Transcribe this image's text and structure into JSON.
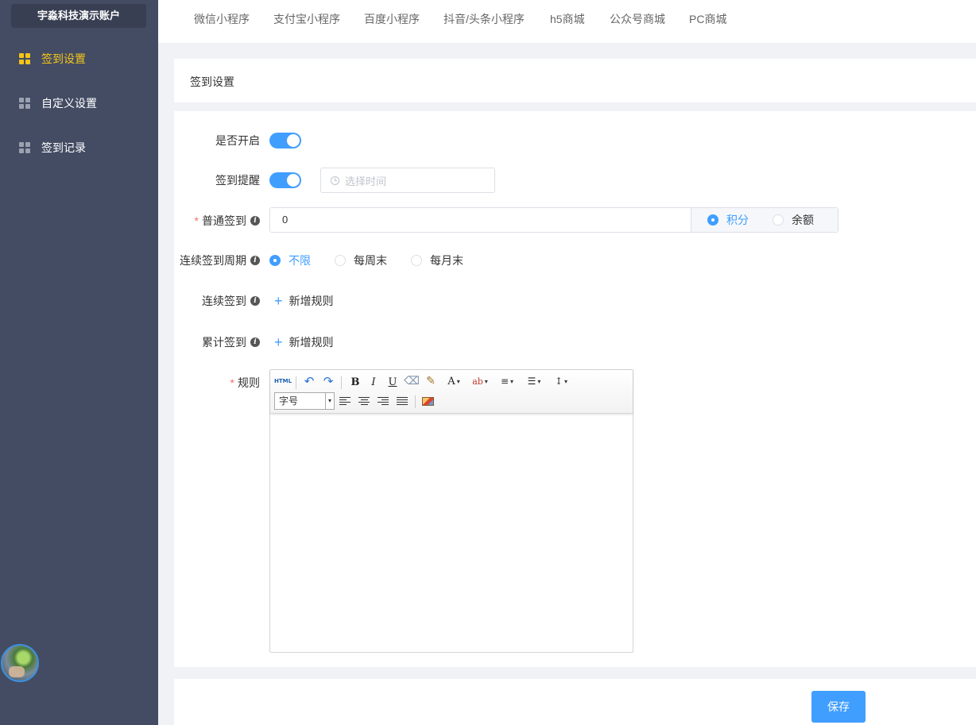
{
  "sidebar": {
    "account": "宇淼科技演示账户",
    "items": [
      {
        "label": "签到设置",
        "active": true
      },
      {
        "label": "自定义设置",
        "active": false
      },
      {
        "label": "签到记录",
        "active": false
      }
    ]
  },
  "tabs": [
    "微信小程序",
    "支付宝小程序",
    "百度小程序",
    "抖音/头条小程序",
    "h5商城",
    "公众号商城",
    "PC商城"
  ],
  "page_title": "签到设置",
  "form": {
    "enable": {
      "label": "是否开启",
      "value": true
    },
    "remind": {
      "label": "签到提醒",
      "value": true,
      "time_placeholder": "选择时间"
    },
    "normal": {
      "label": "普通签到",
      "required": true,
      "value": "0",
      "options": [
        "积分",
        "余额"
      ],
      "selected": "积分"
    },
    "cycle": {
      "label": "连续签到周期",
      "options": [
        "不限",
        "每周末",
        "每月末"
      ],
      "selected": "不限"
    },
    "continuous": {
      "label": "连续签到",
      "add_label": "新增规则"
    },
    "cumulative": {
      "label": "累计签到",
      "add_label": "新增规则"
    },
    "rules": {
      "label": "规则",
      "required": true,
      "font_size_placeholder": "字号",
      "html_label": "HTML"
    }
  },
  "save_label": "保存",
  "colors": {
    "primary": "#409eff",
    "sidebar_bg": "#434c63",
    "active_menu": "#f5c518"
  }
}
